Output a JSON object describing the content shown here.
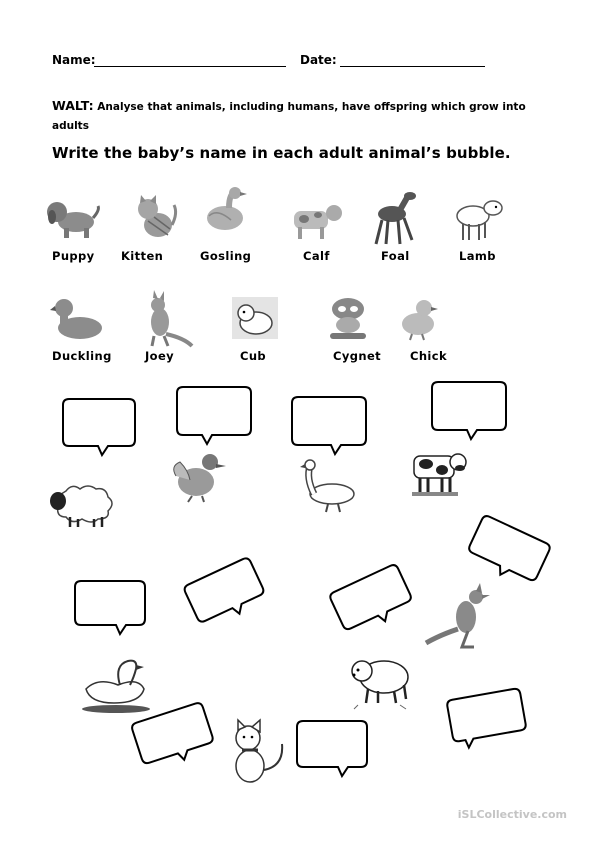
{
  "header": {
    "name_label": "Name:",
    "date_label": "Date:"
  },
  "walt": {
    "prefix": "WALT:",
    "text": "Analyse that animals, including humans, have offspring which grow into adults"
  },
  "instruction": "Write the baby’s name in each adult animal’s bubble.",
  "baby_animals_row1": [
    "Puppy",
    "Kitten",
    "Gosling",
    "Calf",
    "Foal",
    "Lamb"
  ],
  "baby_animals_row2": [
    "Duckling",
    "Joey",
    "Cub",
    "Cygnet",
    "Chick"
  ],
  "adult_animals": [
    "sheep",
    "duck",
    "goose",
    "cow",
    "kangaroo",
    "swan",
    "polar-bear",
    "cat"
  ],
  "colors": {
    "ink": "#000000",
    "image_gray": "#8c8c8c",
    "footer_gray": "#c4c4c4"
  },
  "footer": "iSLCollective.com"
}
